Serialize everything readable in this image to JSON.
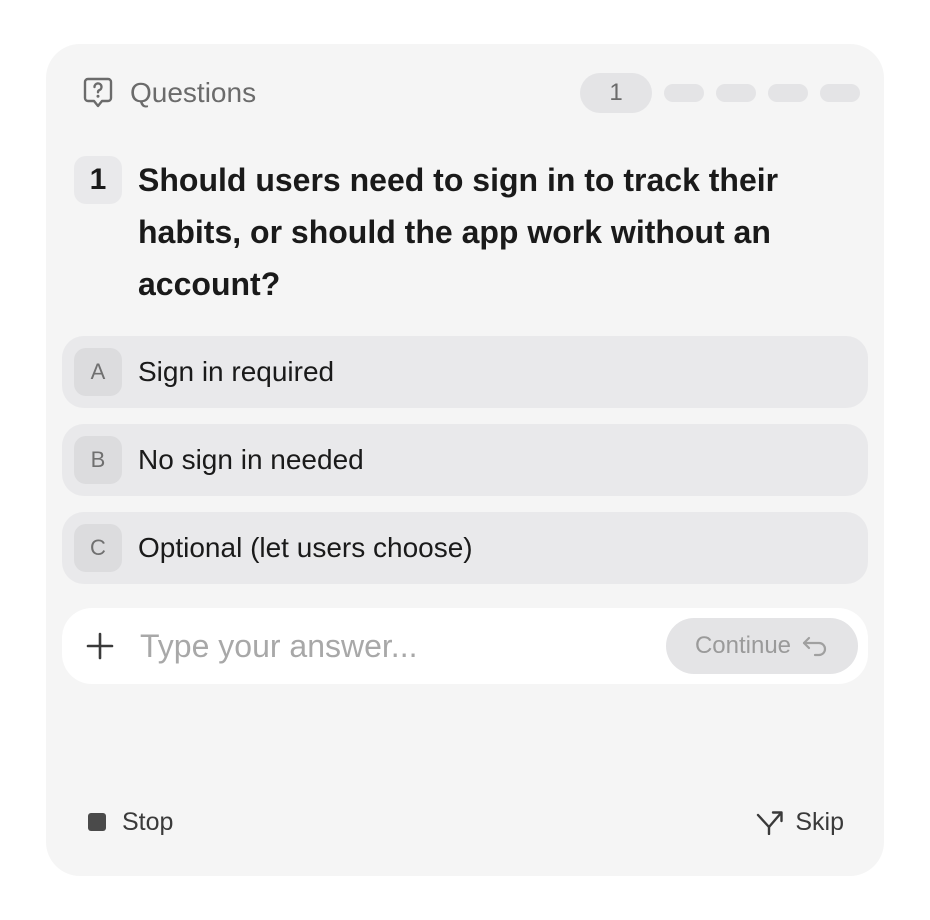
{
  "header": {
    "title": "Questions",
    "icon": "question-bubble-icon",
    "current_step": "1",
    "total_steps": 5
  },
  "question": {
    "number": "1",
    "text": "Should users need to sign in to track their habits, or should the app work without an account?"
  },
  "options": [
    {
      "letter": "A",
      "label": "Sign in required"
    },
    {
      "letter": "B",
      "label": "No sign in needed"
    },
    {
      "letter": "C",
      "label": "Optional (let users choose)"
    }
  ],
  "answer": {
    "placeholder": "Type your answer...",
    "value": "",
    "continue_label": "Continue",
    "add_icon": "plus-icon",
    "continue_icon": "return-arrow-icon"
  },
  "footer": {
    "stop_label": "Stop",
    "skip_label": "Skip",
    "stop_icon": "stop-square-icon",
    "skip_icon": "fork-arrow-icon"
  },
  "colors": {
    "card_bg": "#f5f5f5",
    "option_bg": "#e9e9eb",
    "text_primary": "#1a1a1a",
    "text_muted": "#6b6b6b",
    "placeholder": "#a8a8a8"
  }
}
